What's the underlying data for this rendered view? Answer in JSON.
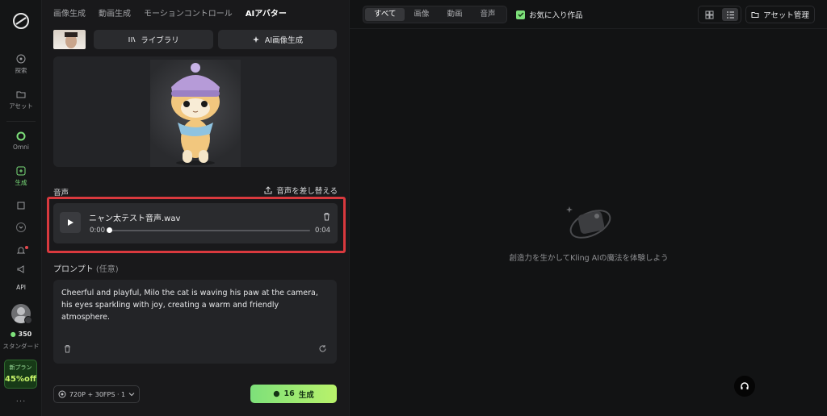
{
  "rail": {
    "items": [
      {
        "label": "探索"
      },
      {
        "label": "アセット"
      },
      {
        "label": "Omni"
      },
      {
        "label": "生成"
      },
      {
        "label": "API"
      }
    ],
    "credits": "350",
    "plan": "スタンダード",
    "promo_top": "新プラン",
    "promo_off": "45%off",
    "more": "..."
  },
  "topnav": {
    "tabs": [
      "画像生成",
      "動画生成",
      "モーションコントロール",
      "AIアバター"
    ],
    "active": "AIアバター"
  },
  "buttons": {
    "library": "ライブラリ",
    "ai_image": "AI画像生成"
  },
  "audio": {
    "section_label": "音声",
    "replace_label": "音声を差し替える",
    "file_name": "ニャン太テスト音声.wav",
    "current_time": "0:00",
    "duration": "0:04"
  },
  "prompt": {
    "label": "プロンプト",
    "optional": "(任意)",
    "text": "Cheerful and playful, Milo the cat is waving his paw at the camera, his eyes sparkling with joy, creating a warm and friendly atmosphere."
  },
  "footer": {
    "settings": "720P + 30FPS · 1",
    "generate_cost": "16",
    "generate_label": "生成"
  },
  "right": {
    "filters": [
      "すべて",
      "画像",
      "動画",
      "音声"
    ],
    "active_filter": "すべて",
    "favorites": "お気に入り作品",
    "asset_manage": "アセット管理",
    "empty_text": "創造力を生かしてKling AIの魔法を体験しよう"
  },
  "colors": {
    "accent": "#7de07a",
    "highlight": "#d9393e",
    "background": "#121314"
  }
}
